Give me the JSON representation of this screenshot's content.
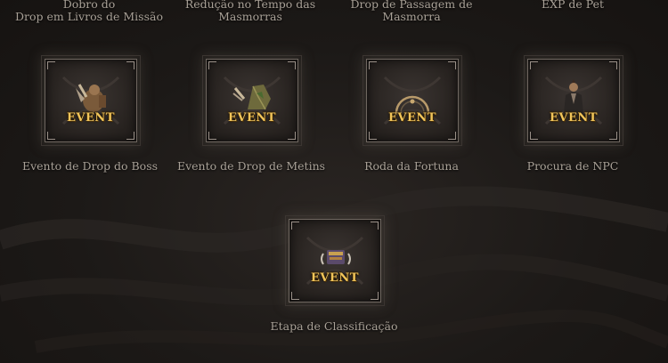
{
  "top_labels": [
    {
      "line1": "Dobro do",
      "line2": "Drop em Livros de Missão"
    },
    {
      "line1": "Redução no Tempo das",
      "line2": "Masmorras"
    },
    {
      "line1": "Drop de Passagem de",
      "line2": "Masmorra"
    },
    {
      "line1": "EXP de Pet",
      "line2": ""
    }
  ],
  "events": [
    {
      "badge": "EVENT",
      "label": "Evento de Drop do Boss",
      "icon": "boss-icon"
    },
    {
      "badge": "EVENT",
      "label": "Evento de Drop de Metins",
      "icon": "metin-stone-icon"
    },
    {
      "badge": "EVENT",
      "label": "Roda da Fortuna",
      "icon": "fortune-wheel-icon"
    },
    {
      "badge": "EVENT",
      "label": "Procura de NPC",
      "icon": "npc-character-icon"
    },
    {
      "badge": "EVENT",
      "label": "Etapa de Classificação",
      "icon": "ranking-trophy-icon"
    }
  ],
  "colors": {
    "badge": "#f2c55a",
    "label": "#a9a197",
    "background": "#1c1917"
  }
}
